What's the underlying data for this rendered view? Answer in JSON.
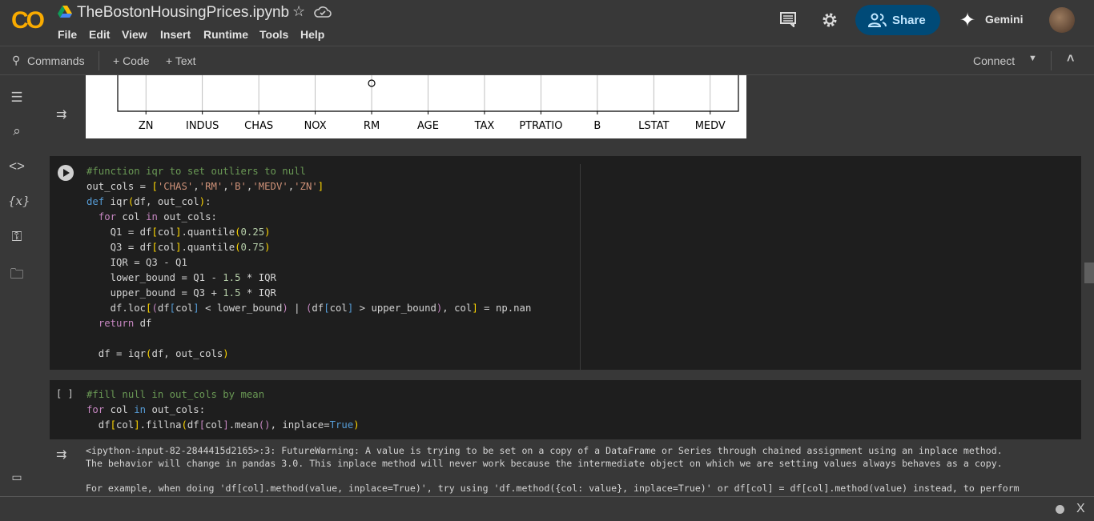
{
  "app": {
    "logo": "CO",
    "title": "TheBostonHousingPrices.ipynb"
  },
  "menu": [
    "File",
    "Edit",
    "View",
    "Insert",
    "Runtime",
    "Tools",
    "Help"
  ],
  "header": {
    "share": "Share",
    "gemini": "Gemini",
    "icons": [
      "comment-icon",
      "gear-icon",
      "share-people-icon",
      "gemini-sparkle-icon",
      "avatar"
    ]
  },
  "toolbar": {
    "commands": "Commands",
    "code": "+ Code",
    "text": "+ Text",
    "connect": "Connect"
  },
  "sidebar": {
    "icons": [
      "toc-icon",
      "find-icon",
      "code-snippets-icon",
      "variables-icon",
      "secrets-key-icon",
      "folder-icon",
      "terminal-icon"
    ],
    "variables_glyph": "{x}"
  },
  "chart_data": {
    "type": "boxplot",
    "categories": [
      "ZN",
      "INDUS",
      "CHAS",
      "NOX",
      "RM",
      "AGE",
      "TAX",
      "PTRATIO",
      "B",
      "LSTAT",
      "MEDV"
    ],
    "grid": true,
    "visible_outliers": [
      {
        "category": "RM"
      }
    ]
  },
  "cells": [
    {
      "run_state": "run",
      "lines": [
        [
          [
            "#function iqr to set outliers to null",
            "cm"
          ]
        ],
        [
          [
            "out_cols = ",
            ""
          ],
          [
            "[",
            "br"
          ],
          [
            "'CHAS'",
            "st"
          ],
          [
            ",",
            ""
          ],
          [
            "'RM'",
            "st"
          ],
          [
            ",",
            ""
          ],
          [
            "'B'",
            "st"
          ],
          [
            ",",
            ""
          ],
          [
            "'MEDV'",
            "st"
          ],
          [
            ",",
            ""
          ],
          [
            "'ZN'",
            "st"
          ],
          [
            "]",
            "br"
          ]
        ],
        [
          [
            "def",
            "kw"
          ],
          [
            " iqr",
            ""
          ],
          [
            "(",
            "br"
          ],
          [
            "df, out_col",
            ""
          ],
          [
            ")",
            "br"
          ],
          [
            ":",
            ""
          ]
        ],
        [
          [
            "  ",
            ""
          ],
          [
            "for",
            "ct"
          ],
          [
            " col ",
            ""
          ],
          [
            "in",
            "ct"
          ],
          [
            " out_cols:",
            ""
          ]
        ],
        [
          [
            "    Q1 = df",
            ""
          ],
          [
            "[",
            "br"
          ],
          [
            "col",
            ""
          ],
          [
            "]",
            "br"
          ],
          [
            ".quantile",
            ""
          ],
          [
            "(",
            "br"
          ],
          [
            "0.25",
            "nu"
          ],
          [
            ")",
            "br"
          ]
        ],
        [
          [
            "    Q3 = df",
            ""
          ],
          [
            "[",
            "br"
          ],
          [
            "col",
            ""
          ],
          [
            "]",
            "br"
          ],
          [
            ".quantile",
            ""
          ],
          [
            "(",
            "br"
          ],
          [
            "0.75",
            "nu"
          ],
          [
            ")",
            "br"
          ]
        ],
        [
          [
            "    IQR = Q3 - Q1",
            ""
          ]
        ],
        [
          [
            "    lower_bound = Q1 - ",
            ""
          ],
          [
            "1.5",
            "nu"
          ],
          [
            " * IQR",
            ""
          ]
        ],
        [
          [
            "    upper_bound = Q3 + ",
            ""
          ],
          [
            "1.5",
            "nu"
          ],
          [
            " * IQR",
            ""
          ]
        ],
        [
          [
            "    df.loc",
            ""
          ],
          [
            "[",
            "br"
          ],
          [
            "(",
            "ct"
          ],
          [
            "df",
            ""
          ],
          [
            "[",
            "kw"
          ],
          [
            "col",
            ""
          ],
          [
            "]",
            "kw"
          ],
          [
            " < lower_bound",
            ""
          ],
          [
            ")",
            "ct"
          ],
          [
            " | ",
            ""
          ],
          [
            "(",
            "ct"
          ],
          [
            "df",
            ""
          ],
          [
            "[",
            "kw"
          ],
          [
            "col",
            ""
          ],
          [
            "]",
            "kw"
          ],
          [
            " > upper_bound",
            ""
          ],
          [
            ")",
            "ct"
          ],
          [
            ", col",
            ""
          ],
          [
            "]",
            "br"
          ],
          [
            " = np.nan",
            ""
          ]
        ],
        [
          [
            "  ",
            ""
          ],
          [
            "return",
            "ct"
          ],
          [
            " df",
            ""
          ]
        ],
        [
          [
            "",
            ""
          ]
        ],
        [
          [
            "  df = iqr",
            ""
          ],
          [
            "(",
            "br"
          ],
          [
            "df, out_cols",
            ""
          ],
          [
            ")",
            "br"
          ]
        ]
      ]
    },
    {
      "run_state": "[ ]",
      "lines": [
        [
          [
            "#fill null in out_cols by mean",
            "cm"
          ]
        ],
        [
          [
            "for",
            "ct"
          ],
          [
            " col ",
            ""
          ],
          [
            "in",
            "kw"
          ],
          [
            " out_cols:",
            ""
          ]
        ],
        [
          [
            "  df",
            ""
          ],
          [
            "[",
            "br"
          ],
          [
            "col",
            ""
          ],
          [
            "]",
            "br"
          ],
          [
            ".fillna",
            ""
          ],
          [
            "(",
            "br"
          ],
          [
            "df",
            ""
          ],
          [
            "[",
            "ct"
          ],
          [
            "col",
            ""
          ],
          [
            "]",
            "ct"
          ],
          [
            ".mean",
            ""
          ],
          [
            "()",
            "ct"
          ],
          [
            ", inplace=",
            ""
          ],
          [
            "True",
            "kw"
          ],
          [
            ")",
            "br"
          ]
        ]
      ]
    }
  ],
  "output": {
    "lines": [
      "<ipython-input-82-2844415d2165>:3: FutureWarning: A value is trying to be set on a copy of a DataFrame or Series through chained assignment using an inplace method.",
      "The behavior will change in pandas 3.0. This inplace method will never work because the intermediate object on which we are setting values always behaves as a copy.",
      "",
      "For example, when doing 'df[col].method(value, inplace=True)', try using 'df.method({col: value}, inplace=True)' or df[col] = df[col].method(value) instead, to perform"
    ]
  },
  "status": {
    "close": "X"
  }
}
